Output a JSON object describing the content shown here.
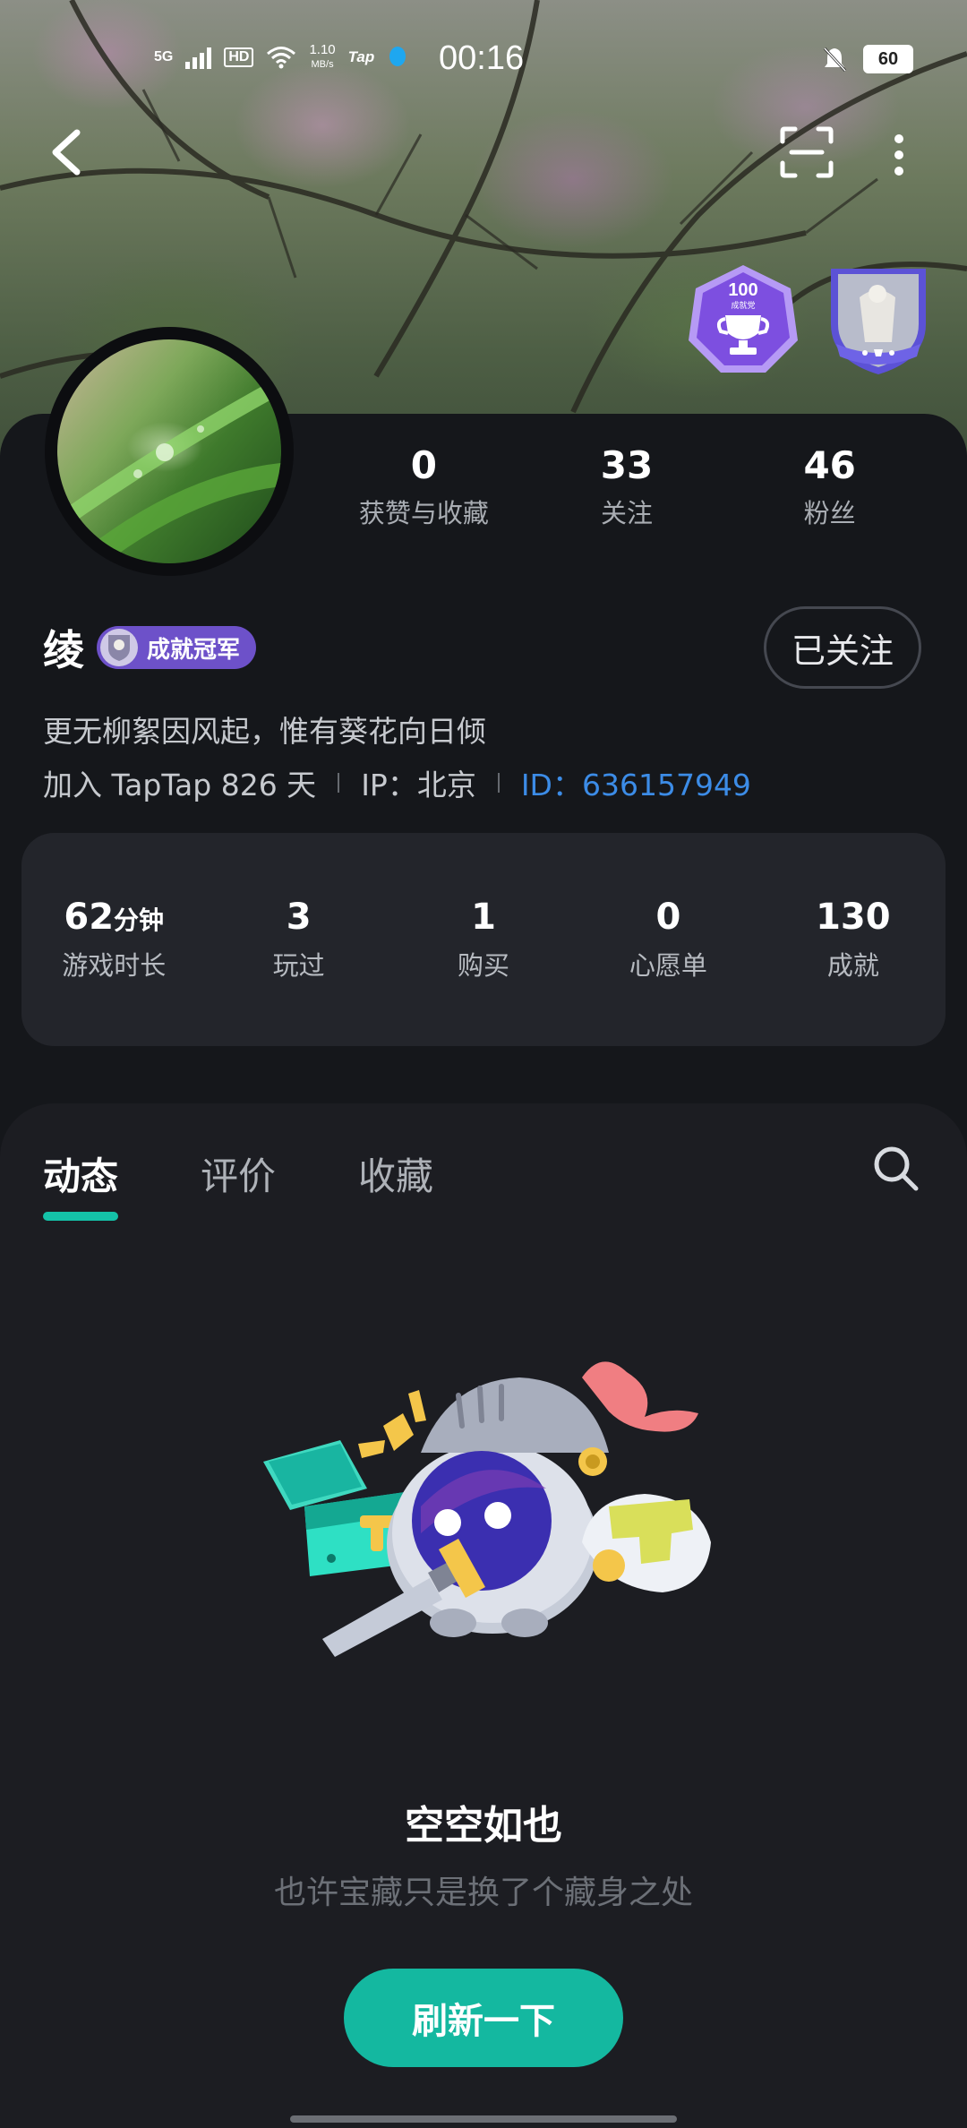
{
  "status_bar": {
    "network": "5G",
    "hd": "HD",
    "speed_value": "1.10",
    "speed_unit": "MB/s",
    "app_mark": "Tap",
    "time": "00:16",
    "battery": "60"
  },
  "badges": {
    "achievement_count": "100",
    "achievement_caption": "成就党"
  },
  "stats": [
    {
      "value": "0",
      "label": "获赞与收藏"
    },
    {
      "value": "33",
      "label": "关注"
    },
    {
      "value": "46",
      "label": "粉丝"
    }
  ],
  "profile": {
    "name": "绫",
    "tag": "成就冠军",
    "follow_button": "已关注",
    "bio": "更无柳絮因风起，惟有葵花向日倾",
    "joined": "加入 TapTap 826 天",
    "ip": "IP：北京",
    "id": "ID：636157949"
  },
  "game_stats": [
    {
      "value": "62",
      "unit": "分钟",
      "label": "游戏时长"
    },
    {
      "value": "3",
      "unit": "",
      "label": "玩过"
    },
    {
      "value": "1",
      "unit": "",
      "label": "购买"
    },
    {
      "value": "0",
      "unit": "",
      "label": "心愿单"
    },
    {
      "value": "130",
      "unit": "",
      "label": "成就"
    }
  ],
  "tabs": [
    {
      "label": "动态",
      "active": true
    },
    {
      "label": "评价",
      "active": false
    },
    {
      "label": "收藏",
      "active": false
    }
  ],
  "empty_state": {
    "title": "空空如也",
    "subtitle": "也许宝藏只是换了个藏身之处",
    "button": "刷新一下"
  },
  "colors": {
    "accent": "#14b8a0",
    "id_link": "#3c8ce7",
    "tag_bg": "#6d51c9"
  }
}
